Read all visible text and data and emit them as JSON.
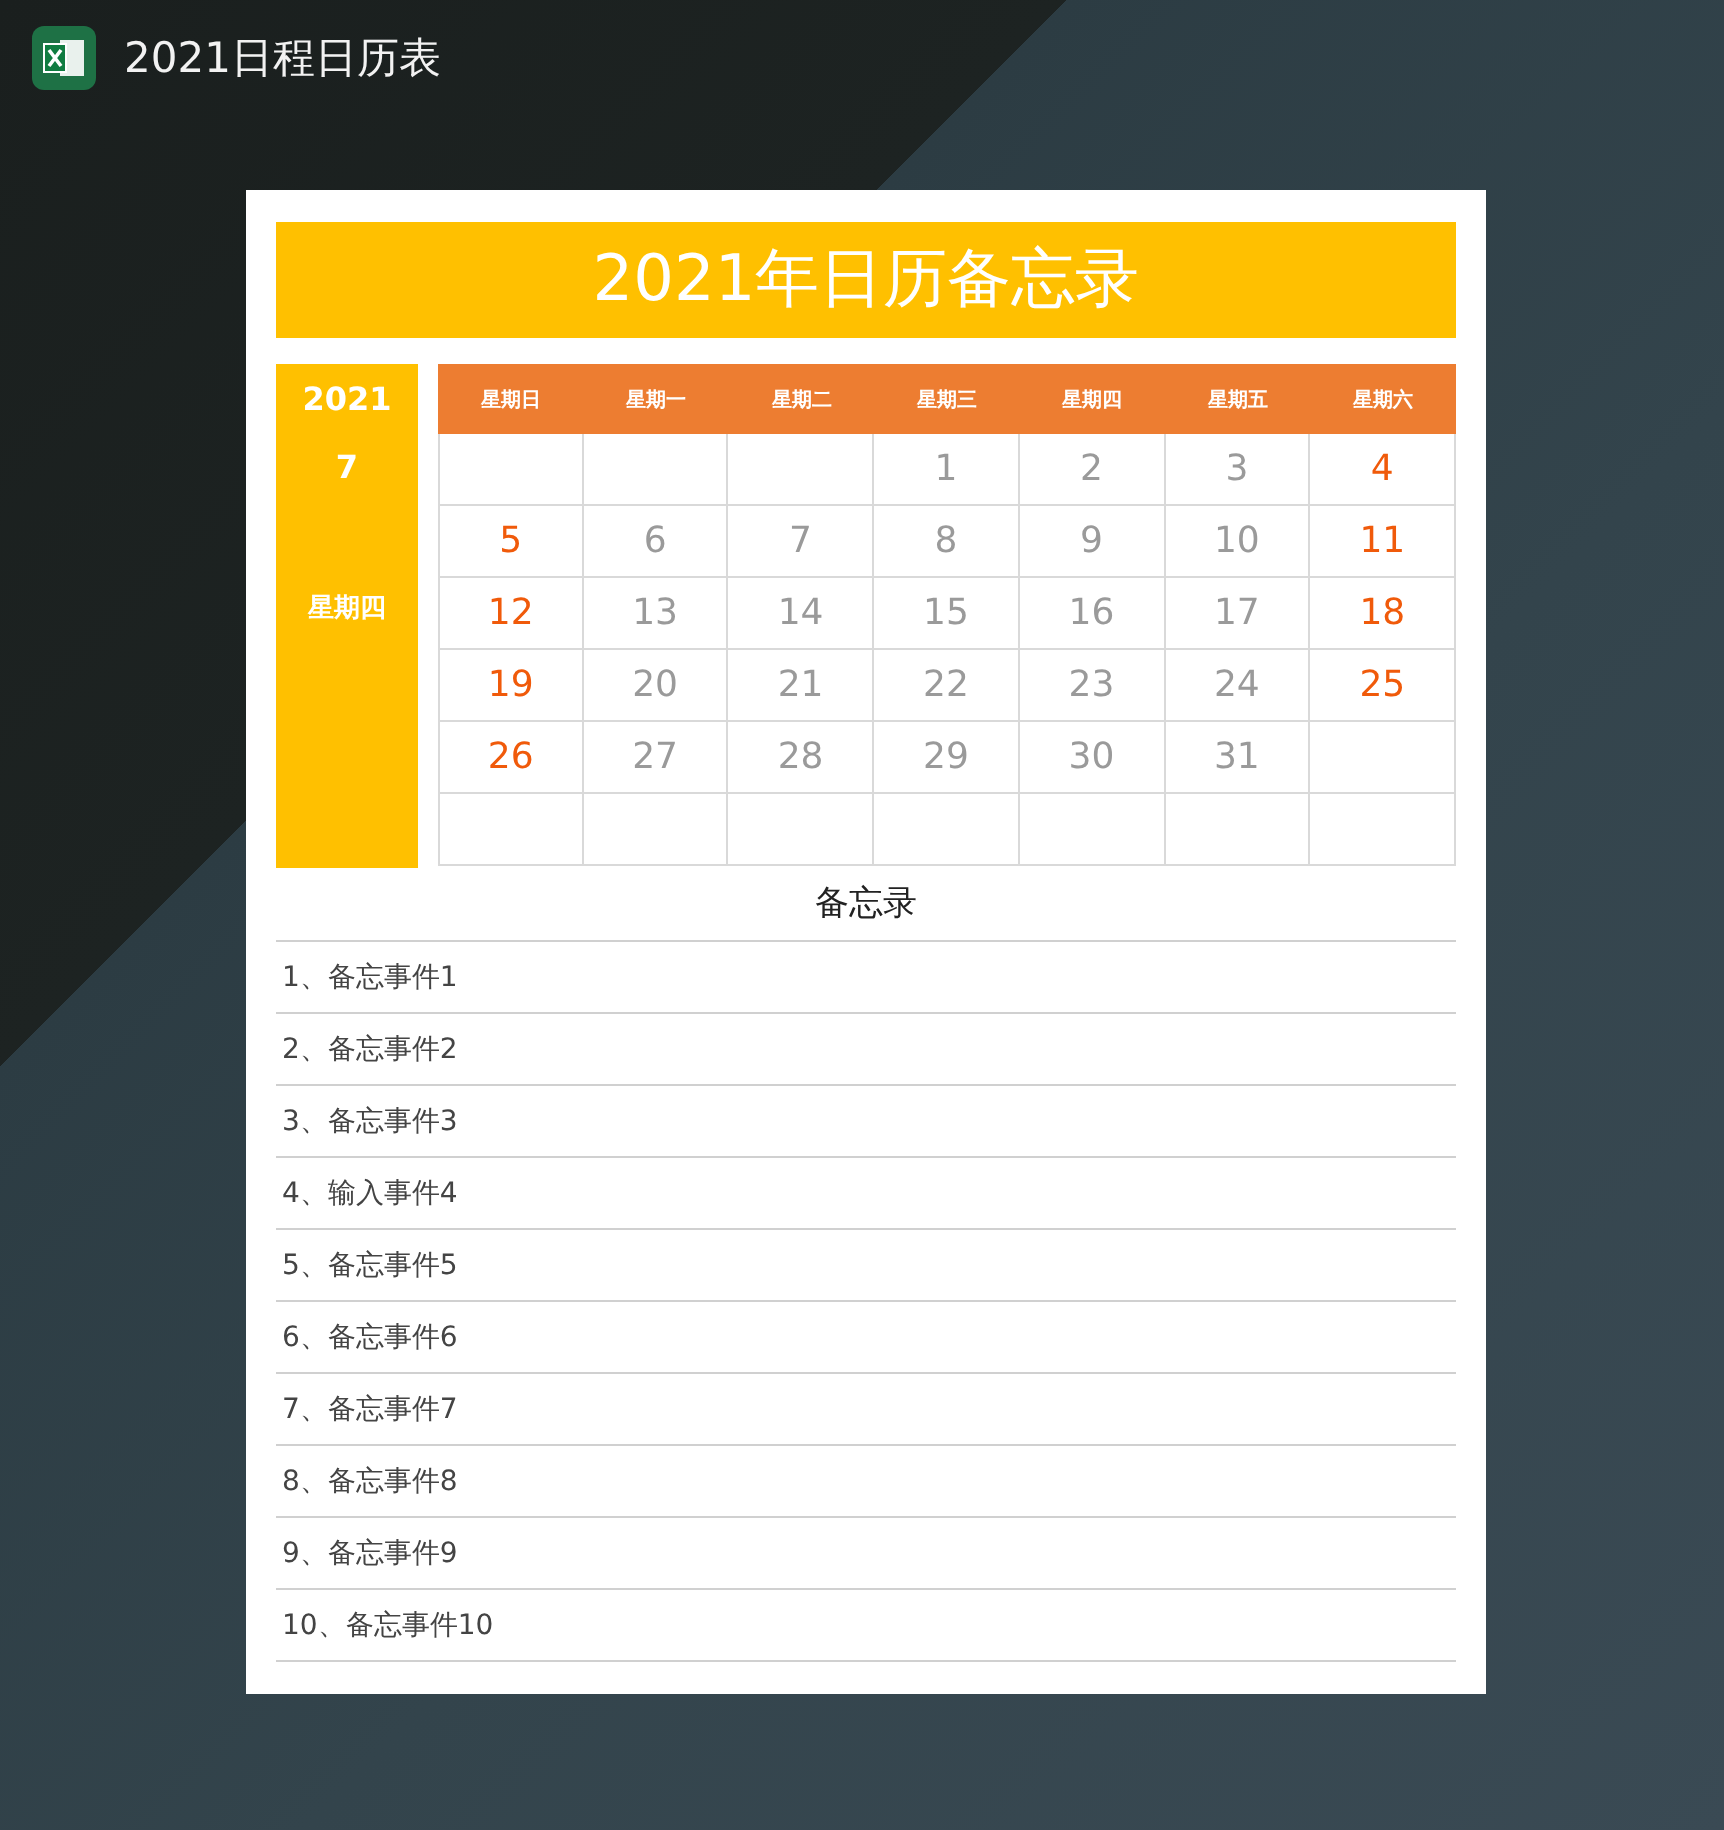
{
  "window": {
    "title": "2021日程日历表"
  },
  "sheet_title": "2021年日历备忘录",
  "side": {
    "year": "2021",
    "month": "7",
    "weekday": "星期四"
  },
  "weekdays": [
    "星期日",
    "星期一",
    "星期二",
    "星期三",
    "星期四",
    "星期五",
    "星期六"
  ],
  "weeks": [
    [
      {
        "kind": "blank"
      },
      {
        "kind": "blank"
      },
      {
        "kind": "blank"
      },
      {
        "kind": "day",
        "day": "1",
        "weekend": false
      },
      {
        "kind": "day",
        "day": "2",
        "weekend": false
      },
      {
        "kind": "day",
        "day": "3",
        "weekend": false
      },
      {
        "kind": "day",
        "day": "4",
        "weekend": true
      }
    ],
    [
      {
        "kind": "day",
        "day": "5",
        "weekend": true
      },
      {
        "kind": "day",
        "day": "6",
        "weekend": false
      },
      {
        "kind": "day",
        "day": "7",
        "weekend": false
      },
      {
        "kind": "day",
        "day": "8",
        "weekend": false
      },
      {
        "kind": "day",
        "day": "9",
        "weekend": false
      },
      {
        "kind": "day",
        "day": "10",
        "weekend": false
      },
      {
        "kind": "day",
        "day": "11",
        "weekend": true
      }
    ],
    [
      {
        "kind": "day",
        "day": "12",
        "weekend": true
      },
      {
        "kind": "day",
        "day": "13",
        "weekend": false
      },
      {
        "kind": "day",
        "day": "14",
        "weekend": false
      },
      {
        "kind": "day",
        "day": "15",
        "weekend": false
      },
      {
        "kind": "day",
        "day": "16",
        "weekend": false
      },
      {
        "kind": "day",
        "day": "17",
        "weekend": false
      },
      {
        "kind": "day",
        "day": "18",
        "weekend": true
      }
    ],
    [
      {
        "kind": "day",
        "day": "19",
        "weekend": true
      },
      {
        "kind": "day",
        "day": "20",
        "weekend": false
      },
      {
        "kind": "day",
        "day": "21",
        "weekend": false
      },
      {
        "kind": "day",
        "day": "22",
        "weekend": false
      },
      {
        "kind": "day",
        "day": "23",
        "weekend": false
      },
      {
        "kind": "day",
        "day": "24",
        "weekend": false
      },
      {
        "kind": "day",
        "day": "25",
        "weekend": true
      }
    ],
    [
      {
        "kind": "day",
        "day": "26",
        "weekend": true
      },
      {
        "kind": "day",
        "day": "27",
        "weekend": false
      },
      {
        "kind": "day",
        "day": "28",
        "weekend": false
      },
      {
        "kind": "day",
        "day": "29",
        "weekend": false
      },
      {
        "kind": "day",
        "day": "30",
        "weekend": false
      },
      {
        "kind": "day",
        "day": "31",
        "weekend": false
      },
      {
        "kind": "blank"
      }
    ],
    [
      {
        "kind": "blank"
      },
      {
        "kind": "blank"
      },
      {
        "kind": "blank"
      },
      {
        "kind": "blank"
      },
      {
        "kind": "blank"
      },
      {
        "kind": "blank"
      },
      {
        "kind": "blank"
      }
    ]
  ],
  "memo": {
    "title": "备忘录",
    "items": [
      "1、备忘事件1",
      "2、备忘事件2",
      "3、备忘事件3",
      "4、输入事件4",
      "5、备忘事件5",
      "6、备忘事件6",
      "7、备忘事件7",
      "8、备忘事件8",
      "9、备忘事件9",
      "10、备忘事件10"
    ]
  }
}
